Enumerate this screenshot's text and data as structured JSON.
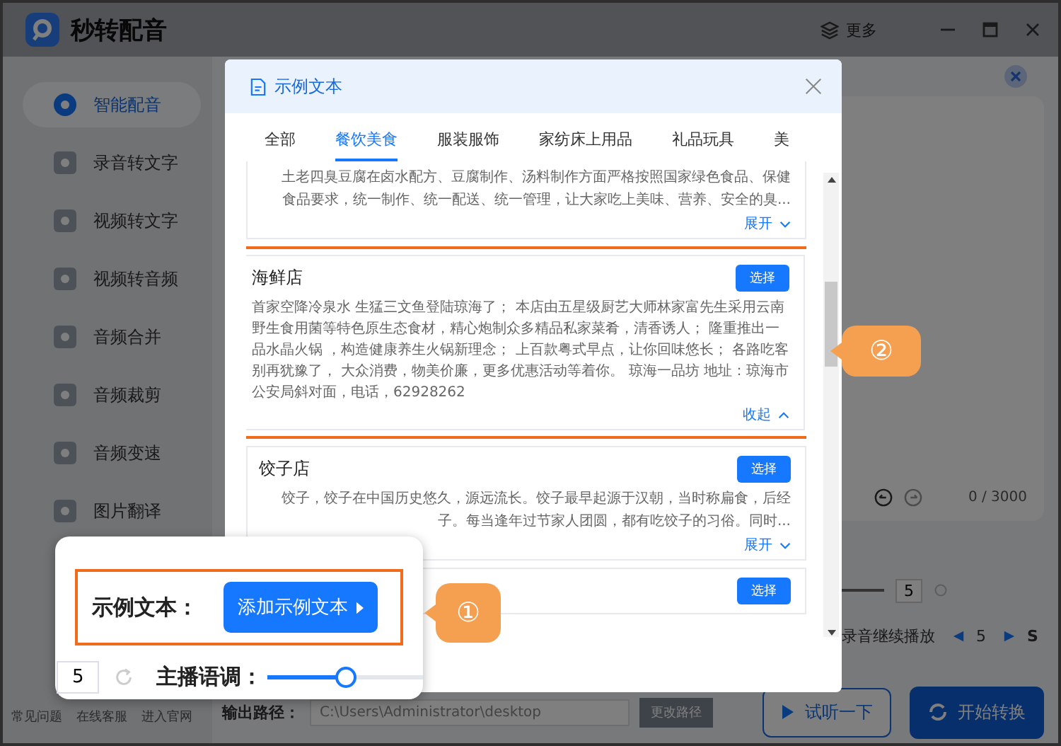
{
  "app": {
    "title": "秒转配音",
    "more": "更多"
  },
  "sidebar": {
    "items": [
      {
        "label": "智能配音",
        "selected": true
      },
      {
        "label": "录音转文字",
        "selected": false
      },
      {
        "label": "视频转文字",
        "selected": false
      },
      {
        "label": "视频转音频",
        "selected": false
      },
      {
        "label": "音频合并",
        "selected": false
      },
      {
        "label": "音频裁剪",
        "selected": false
      },
      {
        "label": "音频变速",
        "selected": false
      },
      {
        "label": "图片翻译",
        "selected": false
      }
    ],
    "help": [
      "常见问题",
      "在线客服",
      "进入官网"
    ]
  },
  "editor": {
    "count": "0 / 3000"
  },
  "settings": {
    "speed_value": "5",
    "playback_label": "录音继续播放",
    "pause_value": "5",
    "pause_unit": "S"
  },
  "output": {
    "label": "输出路径：",
    "path": "C:\\Users\\Administrator\\desktop",
    "change": "更改路径"
  },
  "actions": {
    "preview": "试听一下",
    "convert": "开始转换"
  },
  "dialog": {
    "title": "示例文本",
    "tabs": [
      {
        "label": "全部",
        "selected": false
      },
      {
        "label": "餐饮美食",
        "selected": true
      },
      {
        "label": "服装服饰",
        "selected": false
      },
      {
        "label": "家纺床上用品",
        "selected": false
      },
      {
        "label": "礼品玩具",
        "selected": false
      },
      {
        "label": "美",
        "selected": false
      }
    ],
    "cards": [
      {
        "lines": [
          "土老四臭豆腐在卤水配方、豆腐制作、汤料制作方面严格按照国家绿色食品、保健",
          "食品要求，统一制作、统一配送、统一管理，让大家吃上美味、营养、安全的臭..."
        ],
        "toggle": "展开",
        "expanded": false,
        "highlighted": false
      },
      {
        "title": "海鲜店",
        "select": "选择",
        "text": "首家空降冷泉水 生猛三文鱼登陆琼海了； 本店由五星级厨艺大师林家富先生采用云南野生食用菌等特色原生态食材，精心炮制众多精品私家菜肴，清香诱人； 隆重推出一品水晶火锅 ，构造健康养生火锅新理念； 上百款粤式早点，让你回味悠长； 各路吃客别再犹豫了， 大众消费，物美价廉，更多优惠活动等着你。 琼海一品坊 地址：琼海市公安局斜对面，电话，62928262",
        "toggle": "收起",
        "expanded": true,
        "highlighted": true
      },
      {
        "title": "饺子店",
        "select": "选择",
        "lines": [
          "饺子，饺子在中国历史悠久，源远流长。饺子最早起源于汉朝，当时称扁食，后经",
          "子。每当逢年过节家人团圆，都有吃饺子的习俗。同时..."
        ],
        "toggle": "展开",
        "expanded": false,
        "highlighted": false
      },
      {
        "select": "选择",
        "highlighted": false
      }
    ]
  },
  "popup": {
    "label": "示例文本：",
    "button": "添加示例文本",
    "speed_value": "5",
    "tone_label": "主播语调：",
    "tone": {
      "level": 0.5
    }
  },
  "callouts": [
    "①",
    "②"
  ]
}
